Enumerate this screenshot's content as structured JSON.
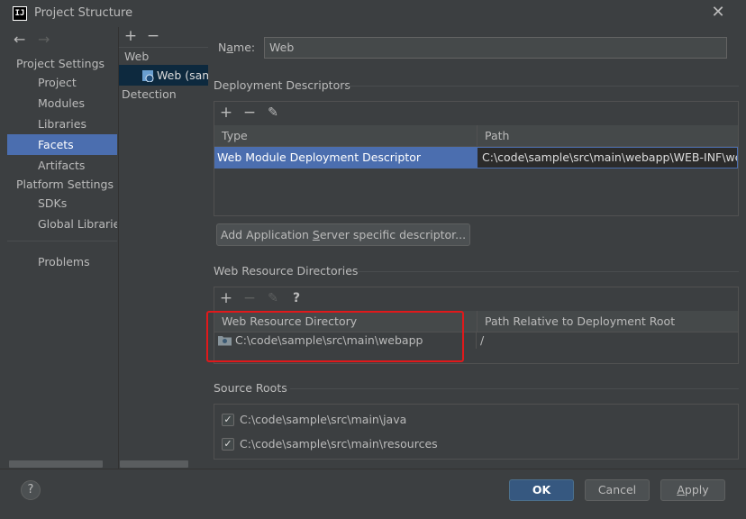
{
  "window": {
    "title": "Project Structure",
    "logo_text": "IJ"
  },
  "nav": {
    "back_glyph": "←",
    "forward_glyph": "→",
    "project_settings_header": "Project Settings",
    "project_items": [
      "Project",
      "Modules",
      "Libraries",
      "Facets",
      "Artifacts"
    ],
    "platform_settings_header": "Platform Settings",
    "platform_items": [
      "SDKs",
      "Global Libraries"
    ],
    "problems": "Problems",
    "selected": "Facets"
  },
  "facets_panel": {
    "add_glyph": "+",
    "remove_glyph": "−",
    "group_label": "Web",
    "facet_item": "Web (sam",
    "detection_label": "Detection"
  },
  "name_field": {
    "label": "Name:",
    "value": "Web"
  },
  "deployment_descriptors": {
    "title": "Deployment Descriptors",
    "headers": {
      "type": "Type",
      "path": "Path"
    },
    "rows": [
      {
        "type": "Web Module Deployment Descriptor",
        "path": "C:\\code\\sample\\src\\main\\webapp\\WEB-INF\\web"
      }
    ],
    "add_server_button": "Add Application Server specific descriptor..."
  },
  "web_resource_directories": {
    "title": "Web Resource Directories",
    "help_glyph": "?",
    "headers": {
      "directory": "Web Resource Directory",
      "relative": "Path Relative to Deployment Root"
    },
    "rows": [
      {
        "directory": "C:\\code\\sample\\src\\main\\webapp",
        "relative": "/"
      }
    ]
  },
  "source_roots": {
    "title": "Source Roots",
    "items": [
      {
        "label": "C:\\code\\sample\\src\\main\\java",
        "checked": true
      },
      {
        "label": "C:\\code\\sample\\src\\main\\resources",
        "checked": true
      }
    ]
  },
  "footer": {
    "help_glyph": "?",
    "ok": "OK",
    "cancel": "Cancel",
    "apply": "Apply"
  },
  "colors": {
    "selection": "#4b6eaf",
    "primary_button": "#365880",
    "highlight_box": "#e0191b"
  }
}
